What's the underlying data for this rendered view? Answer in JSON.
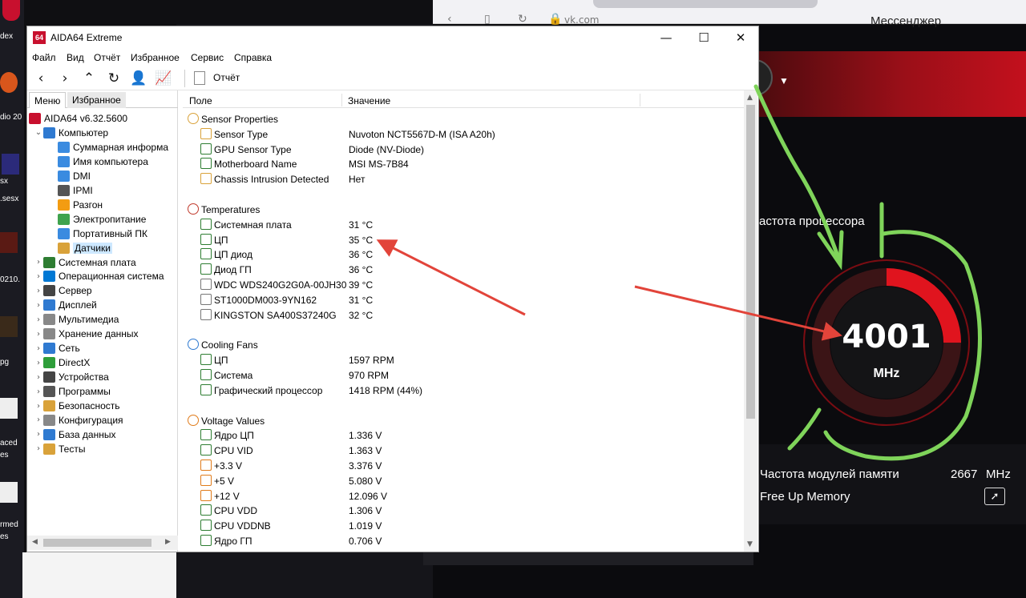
{
  "desktop": {
    "labels": [
      "dex",
      "dio 20",
      "sx",
      ".sesx",
      "0210.",
      "pg",
      "aced",
      "es",
      "rmed",
      "es"
    ]
  },
  "browser": {
    "tab_title": "Мессенджер",
    "url": "vk.com"
  },
  "msi": {
    "cpu_freq_label": "астота процессора",
    "gauge_value": "4001",
    "gauge_unit": "MHz",
    "gauge_fraction": 0.25,
    "mem_freq_label": "Частота модулей памяти",
    "mem_freq_value": "2667",
    "mem_freq_unit": "MHz",
    "free_memory_label": "Free Up Memory",
    "accent": "#e0141e"
  },
  "window": {
    "title": "AIDA64 Extreme",
    "logo": "64",
    "minimize": "—",
    "maximize": "☐",
    "close": "✕"
  },
  "menu": [
    "Файл",
    "Вид",
    "Отчёт",
    "Избранное",
    "Сервис",
    "Справка"
  ],
  "toolbar": {
    "report_label": "Отчёт",
    "icons": [
      "back-icon",
      "forward-icon",
      "up-icon",
      "refresh-icon",
      "user-icon",
      "chart-icon"
    ]
  },
  "left_panel": {
    "tabs": [
      "Меню",
      "Избранное"
    ],
    "tree": [
      {
        "label": "AIDA64 v6.32.5600",
        "level": 0,
        "icon": "aida-icon",
        "chev": ""
      },
      {
        "label": "Компьютер",
        "level": 1,
        "icon": "computer-icon",
        "chev": "⌄"
      },
      {
        "label": "Суммарная информа",
        "level": 2,
        "icon": "summary-icon",
        "chev": ""
      },
      {
        "label": "Имя компьютера",
        "level": 2,
        "icon": "computer-name-icon",
        "chev": ""
      },
      {
        "label": "DMI",
        "level": 2,
        "icon": "dmi-icon",
        "chev": ""
      },
      {
        "label": "IPMI",
        "level": 2,
        "icon": "ipmi-icon",
        "chev": ""
      },
      {
        "label": "Разгон",
        "level": 2,
        "icon": "flame-icon",
        "chev": ""
      },
      {
        "label": "Электропитание",
        "level": 2,
        "icon": "power-icon",
        "chev": ""
      },
      {
        "label": "Портативный ПК",
        "level": 2,
        "icon": "laptop-icon",
        "chev": ""
      },
      {
        "label": "Датчики",
        "level": 2,
        "icon": "sensor-icon",
        "chev": "",
        "selected": true
      },
      {
        "label": "Системная плата",
        "level": 1,
        "icon": "motherboard-icon",
        "chev": "›"
      },
      {
        "label": "Операционная система",
        "level": 1,
        "icon": "windows-icon",
        "chev": "›"
      },
      {
        "label": "Сервер",
        "level": 1,
        "icon": "server-icon",
        "chev": "›"
      },
      {
        "label": "Дисплей",
        "level": 1,
        "icon": "display-icon",
        "chev": "›"
      },
      {
        "label": "Мультимедиа",
        "level": 1,
        "icon": "speaker-icon",
        "chev": "›"
      },
      {
        "label": "Хранение данных",
        "level": 1,
        "icon": "storage-icon",
        "chev": "›"
      },
      {
        "label": "Сеть",
        "level": 1,
        "icon": "network-icon",
        "chev": "›"
      },
      {
        "label": "DirectX",
        "level": 1,
        "icon": "directx-icon",
        "chev": "›"
      },
      {
        "label": "Устройства",
        "level": 1,
        "icon": "devices-icon",
        "chev": "›"
      },
      {
        "label": "Программы",
        "level": 1,
        "icon": "programs-icon",
        "chev": "›"
      },
      {
        "label": "Безопасность",
        "level": 1,
        "icon": "shield-icon",
        "chev": "›"
      },
      {
        "label": "Конфигурация",
        "level": 1,
        "icon": "config-icon",
        "chev": "›"
      },
      {
        "label": "База данных",
        "level": 1,
        "icon": "database-icon",
        "chev": "›"
      },
      {
        "label": "Тесты",
        "level": 1,
        "icon": "tests-icon",
        "chev": "›"
      }
    ]
  },
  "table": {
    "col_field": "Поле",
    "col_value": "Значение",
    "rows": [
      {
        "type": "section",
        "field": "Sensor Properties",
        "icon": "sensor-icon"
      },
      {
        "type": "item",
        "field": "Sensor Type",
        "value": "Nuvoton NCT5567D-M  (ISA A20h)",
        "icon": "sensor-icon"
      },
      {
        "type": "item",
        "field": "GPU Sensor Type",
        "value": "Diode  (NV-Diode)",
        "icon": "gpu-icon"
      },
      {
        "type": "item",
        "field": "Motherboard Name",
        "value": "MSI MS-7B84",
        "icon": "motherboard-icon"
      },
      {
        "type": "item",
        "field": "Chassis Intrusion Detected",
        "value": "Нет",
        "icon": "shield-icon"
      },
      {
        "type": "spacer"
      },
      {
        "type": "section",
        "field": "Temperatures",
        "icon": "thermometer-icon"
      },
      {
        "type": "item",
        "field": "Системная плата",
        "value": "31 °C",
        "icon": "motherboard-icon"
      },
      {
        "type": "item",
        "field": "ЦП",
        "value": "35 °C",
        "icon": "cpu-icon"
      },
      {
        "type": "item",
        "field": "ЦП диод",
        "value": "36 °C",
        "icon": "cpu-icon"
      },
      {
        "type": "item",
        "field": "Диод ГП",
        "value": "36 °C",
        "icon": "cpu-icon"
      },
      {
        "type": "item",
        "field": "WDC WDS240G2G0A-00JH30",
        "value": "39 °C",
        "icon": "drive-icon"
      },
      {
        "type": "item",
        "field": "ST1000DM003-9YN162",
        "value": "31 °C",
        "icon": "drive-icon"
      },
      {
        "type": "item",
        "field": "KINGSTON SA400S37240G",
        "value": "32 °C",
        "icon": "drive-icon"
      },
      {
        "type": "spacer"
      },
      {
        "type": "section",
        "field": "Cooling Fans",
        "icon": "fan-icon"
      },
      {
        "type": "item",
        "field": "ЦП",
        "value": "1597 RPM",
        "icon": "cpu-icon"
      },
      {
        "type": "item",
        "field": "Система",
        "value": "970 RPM",
        "icon": "motherboard-icon"
      },
      {
        "type": "item",
        "field": "Графический процессор",
        "value": "1418 RPM  (44%)",
        "icon": "gpu-icon"
      },
      {
        "type": "spacer"
      },
      {
        "type": "section",
        "field": "Voltage Values",
        "icon": "voltage-icon"
      },
      {
        "type": "item",
        "field": "Ядро ЦП",
        "value": "1.336 V",
        "icon": "cpu-icon"
      },
      {
        "type": "item",
        "field": "CPU VID",
        "value": "1.363 V",
        "icon": "cpu-icon"
      },
      {
        "type": "item",
        "field": "+3.3 V",
        "value": "3.376 V",
        "icon": "voltage-icon"
      },
      {
        "type": "item",
        "field": "+5 V",
        "value": "5.080 V",
        "icon": "voltage-icon"
      },
      {
        "type": "item",
        "field": "+12 V",
        "value": "12.096 V",
        "icon": "voltage-icon"
      },
      {
        "type": "item",
        "field": "CPU VDD",
        "value": "1.306 V",
        "icon": "cpu-icon"
      },
      {
        "type": "item",
        "field": "CPU VDDNB",
        "value": "1.019 V",
        "icon": "cpu-icon"
      },
      {
        "type": "item",
        "field": "Ядро ГП",
        "value": "0.706 V",
        "icon": "gpu-icon"
      }
    ]
  },
  "annotations": {
    "arrow_color": "#e2443a",
    "scribble_color": "#7fd45a"
  }
}
